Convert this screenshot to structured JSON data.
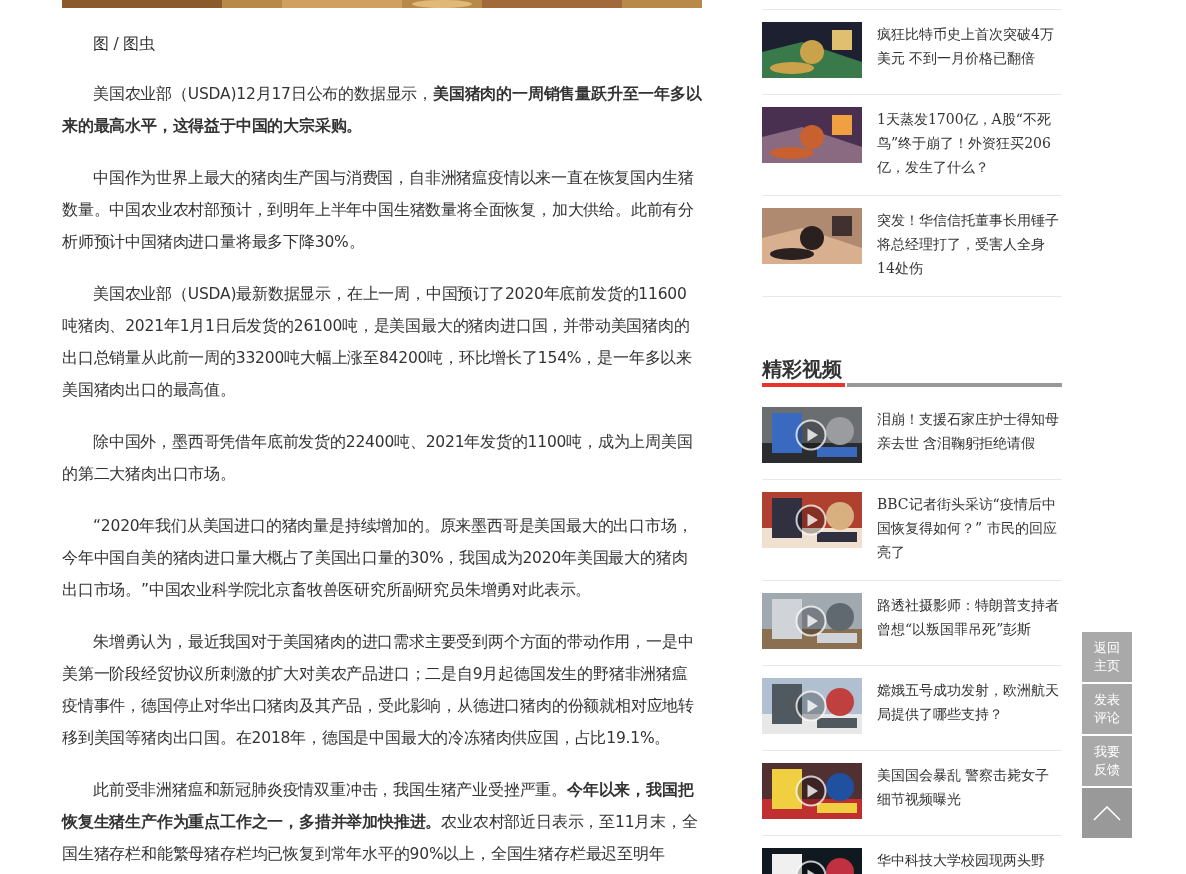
{
  "article": {
    "caption": "图 / 图虫",
    "paragraphs": [
      "美国农业部（USDA)12月17日公布的数据显示，**美国猪肉的一周销售量跃升至一年多以来的最高水平，这得益于中国的大宗采购。**",
      "中国作为世界上最大的猪肉生产国与消费国，自非洲猪瘟疫情以来一直在恢复国内生猪数量。中国农业农村部预计，到明年上半年中国生猪数量将全面恢复，加大供给。此前有分析师预计中国猪肉进口量将最多下降30%。",
      "美国农业部（USDA)最新数据显示，在上一周，中国预订了2020年底前发货的11600吨猪肉、2021年1月1日后发货的26100吨，是美国最大的猪肉进口国，并带动美国猪肉的出口总销量从此前一周的33200吨大幅上涨至84200吨，环比增长了154%，是一年多以来美国猪肉出口的最高值。",
      "除中国外，墨西哥凭借年底前发货的22400吨、2021年发货的1100吨，成为上周美国的第二大猪肉出口市场。",
      "“2020年我们从美国进口的猪肉量是持续增加的。原来墨西哥是美国最大的出口市场，今年中国自美的猪肉进口量大概占了美国出口量的30%，我国成为2020年美国最大的猪肉出口市场。”中国农业科学院北京畜牧兽医研究所副研究员朱增勇对此表示。",
      "朱增勇认为，最近我国对于美国猪肉的进口需求主要受到两个方面的带动作用，一是中美第一阶段经贸协议所刺激的扩大对美农产品进口；二是自9月起德国发生的野猪非洲猪瘟疫情事件，德国停止对华出口猪肉及其产品，受此影响，从德进口猪肉的份额就相对应地转移到美国等猪肉出口国。在2018年，德国是中国最大的冷冻猪肉供应国，占比19.1%。",
      "此前受非洲猪瘟和新冠肺炎疫情双重冲击，我国生猪产业受挫严重。**今年以来，我国把恢复生猪生产作为重点工作之一，多措并举加快推进。**农业农村部近日表示，至11月末，全国生猪存栏和能繁母猪存栏均已恢复到常年水平的90%以上，全国生猪存栏最迟至明年"
    ]
  },
  "news": [
    {
      "title": "疯狂比特币史上首次突破4万美元 不到一月价格已翻倍"
    },
    {
      "title": "1天蒸发1700亿，A股“不死鸟”终于崩了！外资狂买206亿，发生了什么？"
    },
    {
      "title": "突发！华信信托董事长用锤子将总经理打了，受害人全身14处伤"
    }
  ],
  "videos": {
    "heading": "精彩视频",
    "items": [
      {
        "title": "泪崩！支援石家庄护士得知母亲去世 含泪鞠躬拒绝请假"
      },
      {
        "title": "BBC记者街头采访“疫情后中国恢复得如何？” 市民的回应亮了"
      },
      {
        "title": "路透社摄影师：特朗普支持者曾想“以叛国罪吊死”彭斯"
      },
      {
        "title": "嫦娥五号成功发射，欧洲航天局提供了哪些支持？"
      },
      {
        "title": "美国国会暴乱 警察击毙女子细节视频曝光"
      },
      {
        "title": "华中科技大学校园现两头野"
      }
    ]
  },
  "float_buttons": [
    {
      "kind": "text",
      "label": "返回主页"
    },
    {
      "kind": "text",
      "label": "发表评论"
    },
    {
      "kind": "text",
      "label": "我要反馈"
    },
    {
      "kind": "top"
    }
  ]
}
